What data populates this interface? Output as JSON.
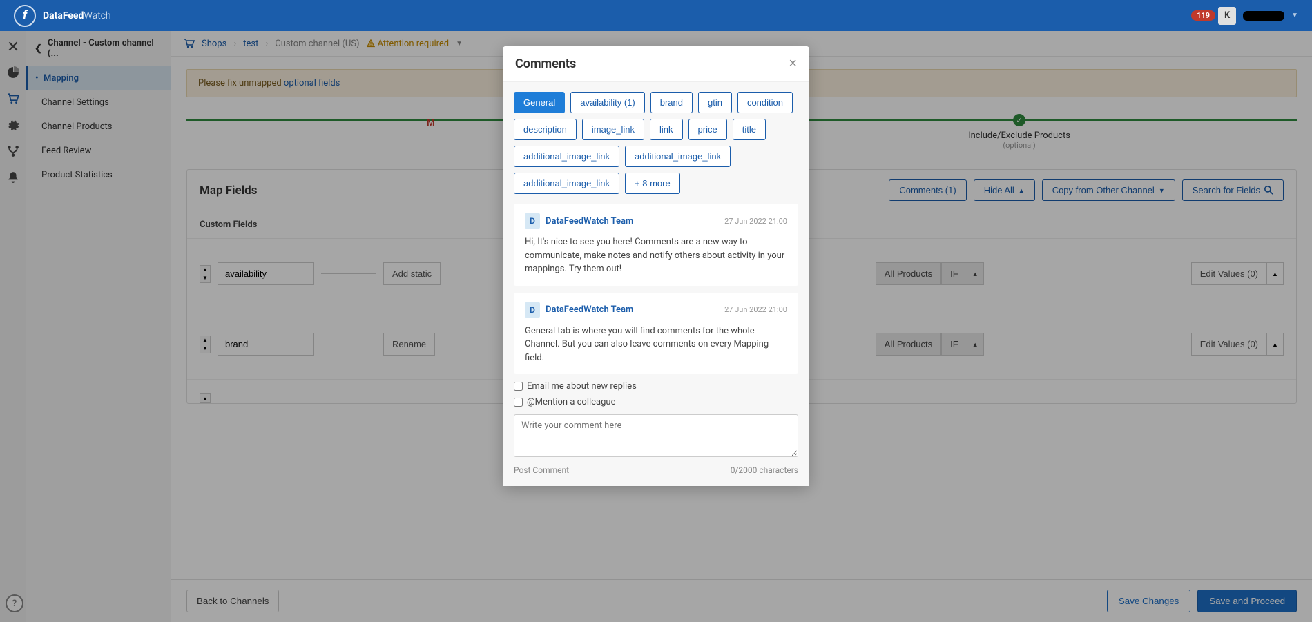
{
  "header": {
    "brand_bold": "DataFeed",
    "brand_light": "Watch",
    "notif_count": "119",
    "avatar_letter": "K"
  },
  "sidebar": {
    "title": "Channel - Custom channel (...",
    "items": [
      {
        "label": "Mapping",
        "active": true
      },
      {
        "label": "Channel Settings"
      },
      {
        "label": "Channel Products"
      },
      {
        "label": "Feed Review"
      },
      {
        "label": "Product Statistics"
      }
    ]
  },
  "breadcrumb": {
    "shops": "Shops",
    "test": "test",
    "channel": "Custom channel (US)",
    "warn": "Attention required"
  },
  "alert": {
    "prefix": "Please fix unmapped ",
    "link": "optional fields"
  },
  "progress": {
    "left_label": "M",
    "right_label": "Include/Exclude Products",
    "right_sub": "(optional)"
  },
  "map": {
    "title": "Map Fields",
    "actions": {
      "comments": "Comments (1)",
      "hide_all": "Hide All",
      "copy": "Copy from Other Channel",
      "search": "Search for Fields"
    },
    "custom_title": "Custom Fields",
    "rows": [
      {
        "name": "availability",
        "action": "Add static",
        "filter": "All Products",
        "if": "IF",
        "edit": "Edit Values (0)"
      },
      {
        "name": "brand",
        "action": "Rename",
        "filter": "All Products",
        "if": "IF",
        "edit": "Edit Values (0)"
      }
    ]
  },
  "footer": {
    "back": "Back to Channels",
    "save": "Save Changes",
    "proceed": "Save and Proceed"
  },
  "modal": {
    "title": "Comments",
    "tags": [
      {
        "label": "General",
        "active": true
      },
      {
        "label": "availability (1)"
      },
      {
        "label": "brand"
      },
      {
        "label": "gtin"
      },
      {
        "label": "condition"
      },
      {
        "label": "description"
      },
      {
        "label": "image_link"
      },
      {
        "label": "link"
      },
      {
        "label": "price"
      },
      {
        "label": "title"
      },
      {
        "label": "additional_image_link"
      },
      {
        "label": "additional_image_link"
      },
      {
        "label": "additional_image_link"
      },
      {
        "label": "+ 8 more"
      }
    ],
    "comments": [
      {
        "avatar": "D",
        "author": "DataFeedWatch Team",
        "time": "27 Jun 2022 21:00",
        "body": "Hi, It's nice to see you here! Comments are a new way to communicate, make notes and notify others about activity in your mappings. Try them out!"
      },
      {
        "avatar": "D",
        "author": "DataFeedWatch Team",
        "time": "27 Jun 2022 21:00",
        "body": "General tab is where you will find comments for the whole Channel. But you can also leave comments on every Mapping field."
      }
    ],
    "email_cb": "Email me about new replies",
    "mention_cb": "@Mention a colleague",
    "placeholder": "Write your comment here",
    "post": "Post Comment",
    "char_count": "0/2000 characters"
  }
}
